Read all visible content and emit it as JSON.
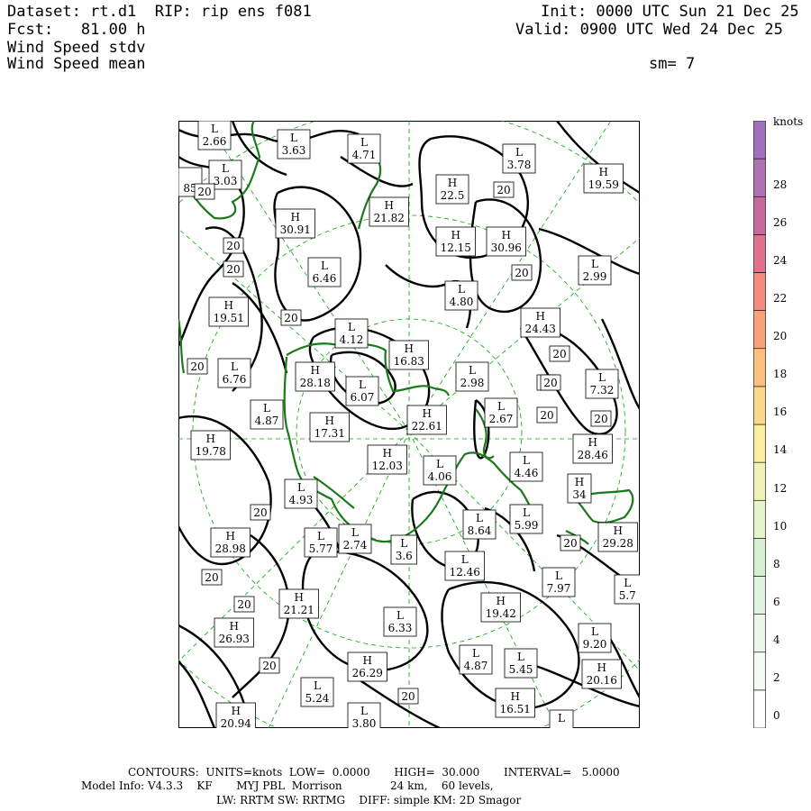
{
  "header": {
    "dataset": "Dataset: rt.d1  RIP: rip ens f081",
    "fcst": "Fcst:   81.00 h",
    "field1": "Wind Speed stdv",
    "field2": "Wind Speed mean",
    "init": "Init: 0000 UTC Sun 21 Dec 25",
    "valid": "Valid: 0900 UTC Wed 24 Dec 25",
    "sm": "sm= 7"
  },
  "colorbar": {
    "unit": "knots",
    "labels": [
      "28",
      "26",
      "24",
      "22",
      "20",
      "18",
      "16",
      "14",
      "12",
      "10",
      "8",
      "6",
      "4",
      "2",
      "0"
    ],
    "colors": [
      "#ffffff",
      "#f4fbf4",
      "#eaf7ea",
      "#e0f4e0",
      "#d4f0d0",
      "#e6f4cc",
      "#f0f2b8",
      "#f8ee9e",
      "#fbd98a",
      "#fbbf80",
      "#f9a27a",
      "#f28a80",
      "#e0708e",
      "#c66a9e",
      "#b070b4",
      "#a070bc"
    ]
  },
  "footer": {
    "line1": "CONTOURS:  UNITS=knots  LOW=  0.0000       HIGH=  30.000       INTERVAL=   5.0000",
    "line2": "Model Info: V4.3.3    KF       MYJ PBL  Morrison              24 km,    60 levels,",
    "line3": "LW: RRTM SW: RRTMG    DIFF: simple KM: 2D Smagor"
  },
  "map_labels": [
    {
      "t": "L",
      "v": "2.66"
    },
    {
      "t": "L",
      "v": "3.63"
    },
    {
      "t": "L",
      "v": "4.71"
    },
    {
      "t": "L",
      "v": "3.78"
    },
    {
      "t": "L",
      "v": "3.03"
    },
    {
      "t": "H",
      "v": "22.5"
    },
    {
      "t": "H",
      "v": "19.59"
    },
    {
      "t": "H",
      "v": "21.82"
    },
    {
      "t": "H",
      "v": "30.91"
    },
    {
      "t": "H",
      "v": "12.15"
    },
    {
      "t": "H",
      "v": "30.96"
    },
    {
      "t": "L",
      "v": "6.46"
    },
    {
      "t": "L",
      "v": "2.99"
    },
    {
      "t": "L",
      "v": "4.80"
    },
    {
      "t": "H",
      "v": "19.51"
    },
    {
      "t": "H",
      "v": "24.43"
    },
    {
      "t": "L",
      "v": "4.12"
    },
    {
      "t": "H",
      "v": "16.83"
    },
    {
      "t": "L",
      "v": "6.76"
    },
    {
      "t": "H",
      "v": "28.18"
    },
    {
      "t": "L",
      "v": "6.07"
    },
    {
      "t": "L",
      "v": "2.98"
    },
    {
      "t": "L",
      "v": "7.32"
    },
    {
      "t": "L",
      "v": "4.87"
    },
    {
      "t": "H",
      "v": "22.61"
    },
    {
      "t": "L",
      "v": "2.67"
    },
    {
      "t": "H",
      "v": "17.31"
    },
    {
      "t": "H",
      "v": "19.78"
    },
    {
      "t": "H",
      "v": "28.46"
    },
    {
      "t": "H",
      "v": "12.03"
    },
    {
      "t": "L",
      "v": "4.06"
    },
    {
      "t": "L",
      "v": "4.46"
    },
    {
      "t": "H",
      "v": "34"
    },
    {
      "t": "L",
      "v": "4.93"
    },
    {
      "t": "L",
      "v": "8.64"
    },
    {
      "t": "L",
      "v": "5.99"
    },
    {
      "t": "H",
      "v": "28.98"
    },
    {
      "t": "L",
      "v": "5.77"
    },
    {
      "t": "L",
      "v": "2.74"
    },
    {
      "t": "L",
      "v": "3.6"
    },
    {
      "t": "H",
      "v": "29.28"
    },
    {
      "t": "L",
      "v": "12.46"
    },
    {
      "t": "L",
      "v": "7.97"
    },
    {
      "t": "L",
      "v": "5.7"
    },
    {
      "t": "H",
      "v": "21.21"
    },
    {
      "t": "H",
      "v": "19.42"
    },
    {
      "t": "H",
      "v": "26.93"
    },
    {
      "t": "L",
      "v": "6.33"
    },
    {
      "t": "L",
      "v": "9.20"
    },
    {
      "t": "L",
      "v": "4.87"
    },
    {
      "t": "L",
      "v": "5.45"
    },
    {
      "t": "H",
      "v": "20.16"
    },
    {
      "t": "H",
      "v": "26.29"
    },
    {
      "t": "L",
      "v": "5.24"
    },
    {
      "t": "H",
      "v": "16.51"
    },
    {
      "t": "H",
      "v": "20.94"
    },
    {
      "t": "L",
      "v": "3.80"
    },
    {
      "t": "L",
      "v": ""
    },
    {
      "t": "",
      "v": "85"
    }
  ],
  "contour_labels": [
    "20",
    "20",
    "20",
    "20",
    "20",
    "20",
    "20",
    "20",
    "20",
    "20",
    "20",
    "20",
    "20",
    "20",
    "20",
    "20",
    "20",
    "20"
  ]
}
